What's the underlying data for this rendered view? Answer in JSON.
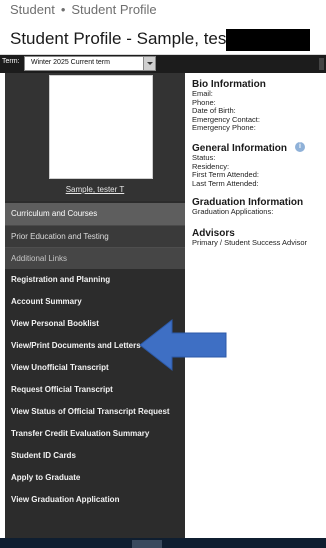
{
  "breadcrumb": {
    "items": [
      "Student",
      "Student Profile"
    ],
    "separator": "•"
  },
  "page_title": "Student Profile - Sample, tester T",
  "term": {
    "label": "Term:",
    "selected": "Winter 2025 Current term"
  },
  "profile": {
    "name": "Sample, tester T"
  },
  "sidebar": {
    "sections": [
      "Curriculum and Courses",
      "Prior Education and Testing",
      "Additional Links"
    ],
    "links": [
      "Registration and Planning",
      "Account Summary",
      "View Personal Booklist",
      "View/Print Documents and Letters",
      "View Unofficial Transcript",
      "Request Official Transcript",
      "View Status of Official Transcript Request",
      "Transfer Credit Evaluation Summary",
      "Student ID Cards",
      "Apply to Graduate",
      "View Graduation Application"
    ]
  },
  "main": {
    "bio": {
      "heading": "Bio Information",
      "fields": [
        "Email:",
        "Phone:",
        "Date of Birth:",
        "Emergency Contact:",
        "Emergency Phone:"
      ]
    },
    "general": {
      "heading": "General Information",
      "fields": [
        "Status:",
        "Residency:",
        "First Term Attended:",
        "Last Term Attended:"
      ]
    },
    "graduation": {
      "heading": "Graduation Information",
      "fields": [
        "Graduation Applications:"
      ]
    },
    "advisors": {
      "heading": "Advisors",
      "fields": [
        "Primary / Student Success Advisor"
      ]
    }
  },
  "annotation": {
    "icon": "arrow-left-icon",
    "color": "#3e6fc4",
    "points_to": "View/Print Documents and Letters"
  },
  "colors": {
    "sidebar_bg": "#2c2c2c",
    "term_bar_bg": "#1c1c1c",
    "info_icon": "#8fb1d8"
  }
}
